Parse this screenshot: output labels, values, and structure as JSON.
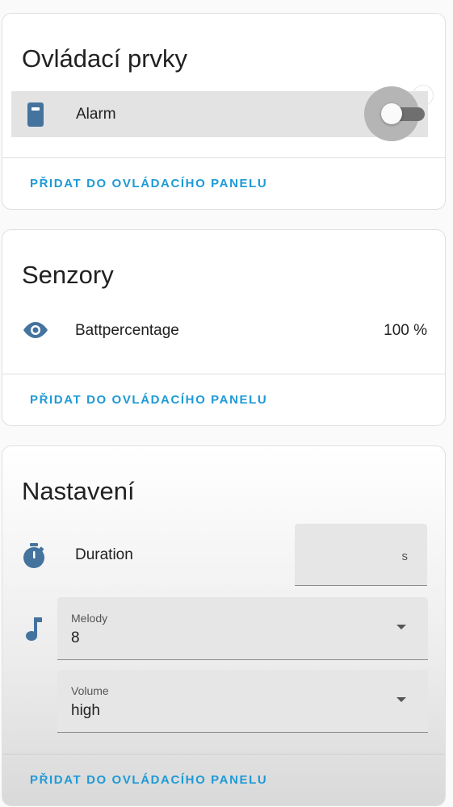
{
  "controls_card": {
    "title": "Ovládací prvky",
    "entity": {
      "name": "Alarm",
      "icon": "doorbell-icon",
      "state": "off"
    },
    "footer_button": "PŘIDAT DO OVLÁDACÍHO PANELU"
  },
  "sensors_card": {
    "title": "Senzory",
    "entity": {
      "name": "Battpercentage",
      "icon": "eye-icon",
      "value": "100 %"
    },
    "footer_button": "PŘIDAT DO OVLÁDACÍHO PANELU"
  },
  "settings_card": {
    "title": "Nastavení",
    "duration": {
      "name": "Duration",
      "icon": "timer-icon",
      "value": "",
      "unit": "s"
    },
    "melody": {
      "icon": "music-note-icon",
      "label": "Melody",
      "value": "8"
    },
    "volume": {
      "label": "Volume",
      "value": "high"
    },
    "footer_button": "PŘIDAT DO OVLÁDACÍHO PANELU"
  },
  "colors": {
    "accent": "#1e9ad6",
    "icon": "#44739e",
    "row_highlight": "#e3e3e3"
  }
}
